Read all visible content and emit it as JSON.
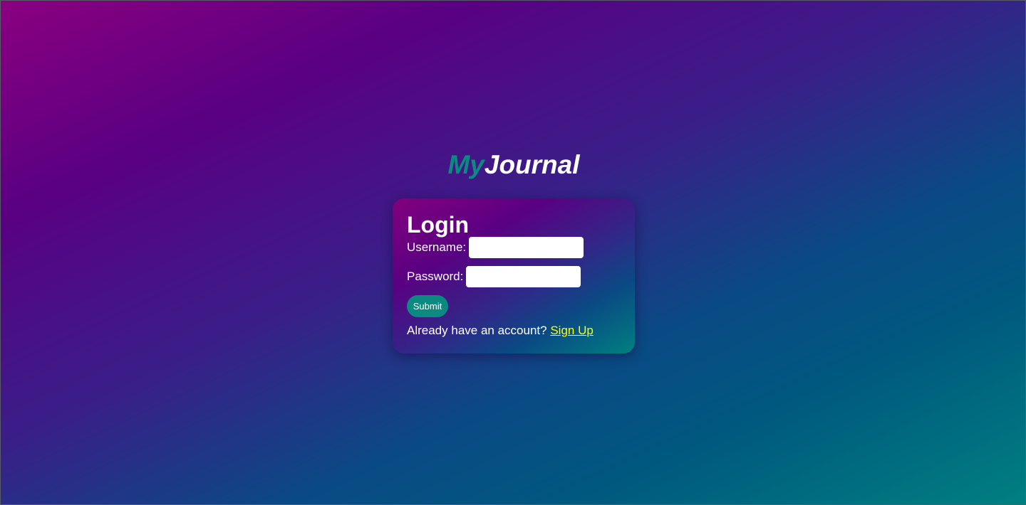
{
  "app": {
    "logo_part1": "My",
    "logo_part2": "Journal"
  },
  "login": {
    "title": "Login",
    "username_label": "Username:",
    "username_value": "",
    "password_label": "Password:",
    "password_value": "",
    "submit_label": "Submit",
    "account_prompt": "Already have an account?",
    "signup_link": "Sign Up"
  },
  "colors": {
    "accent_teal": "#0a8a80",
    "link_yellow": "#ffff00",
    "text_white": "#ffffff"
  }
}
